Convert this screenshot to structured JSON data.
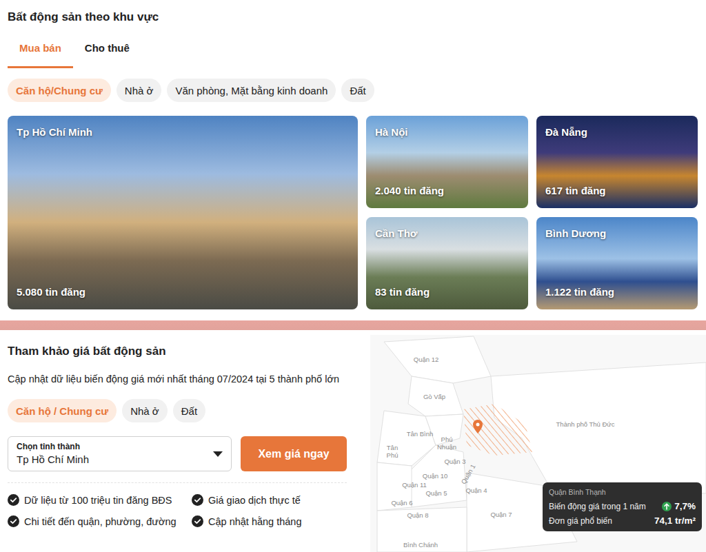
{
  "section_title": "Bất động sản theo khu vực",
  "tabs": [
    {
      "label": "Mua bán",
      "selected": true
    },
    {
      "label": "Cho thuê",
      "selected": false
    }
  ],
  "categories": [
    {
      "label": "Căn hộ/Chung cư",
      "selected": true
    },
    {
      "label": "Nhà ở",
      "selected": false
    },
    {
      "label": "Văn phòng, Mặt bằng kinh doanh",
      "selected": false
    },
    {
      "label": "Đất",
      "selected": false
    }
  ],
  "cities": [
    {
      "name": "Tp Hồ Chí Minh",
      "listings": "5.080 tin đăng"
    },
    {
      "name": "Hà Nội",
      "listings": "2.040 tin đăng"
    },
    {
      "name": "Đà Nẵng",
      "listings": "617 tin đăng"
    },
    {
      "name": "Cần Thơ",
      "listings": "83 tin đăng"
    },
    {
      "name": "Bình Dương",
      "listings": "1.122 tin đăng"
    }
  ],
  "price_section": {
    "title": "Tham khảo giá bất động sản",
    "description": "Cập nhật dữ liệu biến động giá mới nhất tháng 07/2024 tại 5 thành phố lớn",
    "types": [
      {
        "label": "Căn hộ / Chung cư",
        "selected": true
      },
      {
        "label": "Nhà ở",
        "selected": false
      },
      {
        "label": "Đất",
        "selected": false
      }
    ],
    "province_select": {
      "label": "Chọn tỉnh thành",
      "value": "Tp Hồ Chí Minh"
    },
    "button": "Xem giá ngay",
    "features": [
      "Dữ liệu từ 100 triệu tin đăng BĐS",
      "Giá giao dịch thực tế",
      "Chi tiết đến quận, phường, đường",
      "Cập nhật hằng tháng"
    ]
  },
  "map": {
    "districts": [
      "Quận 12",
      "Gò Vấp",
      "Tân Bình",
      "Phú Nhuận",
      "Tân Phú",
      "Thành phố Thủ Đức",
      "Quận 3",
      "Quận 10",
      "Quận 11",
      "Quận 1",
      "Quận 5",
      "Quận 4",
      "Quận 6",
      "Quận 8",
      "Quận 7",
      "Bình Chánh"
    ],
    "tooltip": {
      "district": "Quận Bình Thạnh",
      "rows": [
        {
          "label": "Biến động giá trong 1 năm",
          "value": "7,7%",
          "trend": "up"
        },
        {
          "label": "Đơn giá phổ biến",
          "value": "74,1 tr/m²",
          "trend": "none"
        }
      ]
    }
  }
}
